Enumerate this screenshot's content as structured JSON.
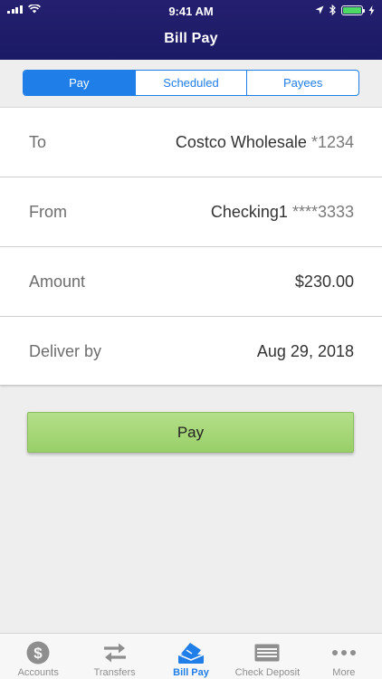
{
  "status_bar": {
    "time": "9:41 AM"
  },
  "header": {
    "title": "Bill Pay"
  },
  "segments": [
    {
      "label": "Pay",
      "active": true
    },
    {
      "label": "Scheduled",
      "active": false
    },
    {
      "label": "Payees",
      "active": false
    }
  ],
  "form": {
    "to": {
      "label": "To",
      "value": "Costco Wholesale",
      "suffix": "*1234"
    },
    "from": {
      "label": "From",
      "value": "Checking1",
      "suffix": "****3333"
    },
    "amount": {
      "label": "Amount",
      "value": "$230.00"
    },
    "deliver_by": {
      "label": "Deliver by",
      "value": "Aug 29, 2018"
    }
  },
  "pay_button": {
    "label": "Pay"
  },
  "tabs": [
    {
      "label": "Accounts",
      "icon": "dollar-circle-icon",
      "active": false
    },
    {
      "label": "Transfers",
      "icon": "transfer-arrows-icon",
      "active": false
    },
    {
      "label": "Bill Pay",
      "icon": "bill-pay-icon",
      "active": true
    },
    {
      "label": "Check Deposit",
      "icon": "check-icon",
      "active": false
    },
    {
      "label": "More",
      "icon": "more-dots-icon",
      "active": false
    }
  ],
  "colors": {
    "header_bg": "#1b1a66",
    "accent": "#1f7ee8",
    "pay_button": "#a6d678",
    "battery": "#4cd964"
  }
}
